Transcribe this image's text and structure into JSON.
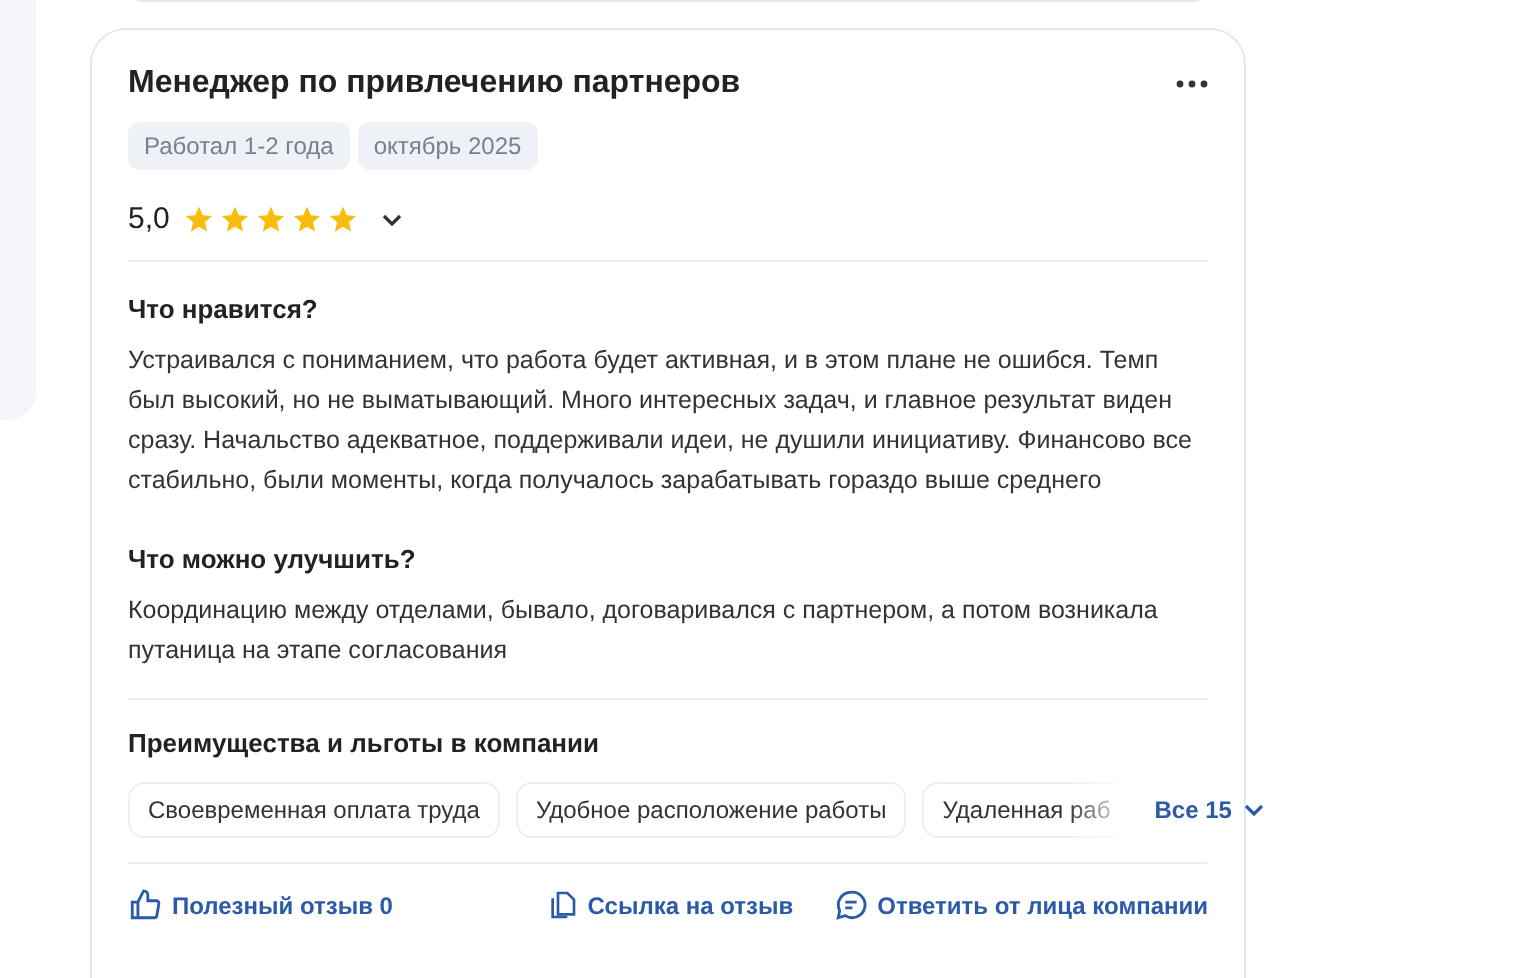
{
  "review": {
    "title": "Менеджер по привлечению партнеров",
    "tags": [
      "Работал 1-2 года",
      "октябрь 2025"
    ],
    "rating": {
      "score": "5,0",
      "stars": 5,
      "expanded": false
    },
    "sections": [
      {
        "heading": "Что нравится?",
        "text": "Устраивался с пониманием, что работа будет активная, и в этом плане не ошибся. Темп был высокий, но не выматывающий. Много интересных задач, и главное результат виден сразу. Начальство адекватное, поддерживали идеи, не душили инициативу. Финансово все стабильно, были моменты, когда получалось зарабатывать гораздо выше среднего"
      },
      {
        "heading": "Что можно улучшить?",
        "text": "Координацию между отделами, бывало, договаривался с партнером, а потом возникала путаница на этапе согласования"
      }
    ],
    "benefits": {
      "heading": "Преимущества и льготы в компании",
      "items": [
        "Своевременная оплата труда",
        "Удобное расположение работы",
        "Удаленная раб"
      ],
      "more": "Все 15"
    },
    "actions": [
      {
        "kind": "like",
        "label": "Полезный отзыв 0"
      },
      {
        "kind": "link",
        "label": "Ссылка на отзыв"
      },
      {
        "kind": "reply",
        "label": "Ответить от лица компании"
      }
    ]
  }
}
